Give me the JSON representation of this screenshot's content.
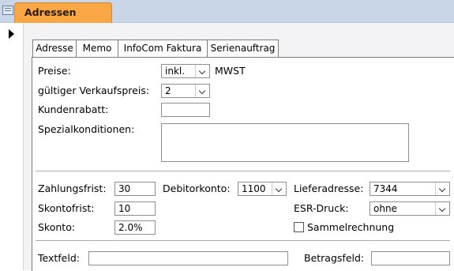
{
  "document_tab": {
    "title": "Adressen"
  },
  "subtabs": [
    {
      "label": "Adresse"
    },
    {
      "label": "Memo"
    },
    {
      "label": "InfoCom Faktura"
    },
    {
      "label": "Serienauftrag"
    }
  ],
  "pricing": {
    "preise_label": "Preise:",
    "preise_value": "inkl.",
    "mwst_label": "MWST",
    "verkaufspreis_label": "gültiger Verkaufspreis:",
    "verkaufspreis_value": "2",
    "kundenrabatt_label": "Kundenrabatt:",
    "kundenrabatt_value": "",
    "spezial_label": "Spezialkonditionen:",
    "spezial_value": ""
  },
  "terms": {
    "zahlungsfrist_label": "Zahlungsfrist:",
    "zahlungsfrist_value": "30",
    "skontofrist_label": "Skontofrist:",
    "skontofrist_value": "10",
    "skonto_label": "Skonto:",
    "skonto_value": "2.0%",
    "debitorkonto_label": "Debitorkonto:",
    "debitorkonto_value": "1100",
    "lieferadresse_label": "Lieferadresse:",
    "lieferadresse_value": "7344",
    "esr_label": "ESR-Druck:",
    "esr_value": "ohne",
    "sammelrechnung_label": "Sammelrechnung"
  },
  "footer": {
    "textfeld_label": "Textfeld:",
    "textfeld_value": "",
    "betragsfeld_label": "Betragsfeld:",
    "betragsfeld_value": ""
  },
  "colors": {
    "active_tab": "#f9a745",
    "tabstrip": "#c8d6e8",
    "form_background": "#f3f2f4"
  }
}
